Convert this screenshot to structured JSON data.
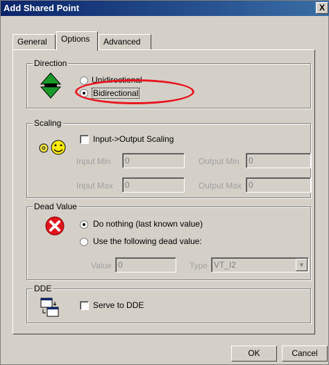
{
  "window": {
    "title": "Add Shared Point",
    "close_label": "X"
  },
  "tabs": [
    {
      "label": "General"
    },
    {
      "label": "Options"
    },
    {
      "label": "Advanced"
    }
  ],
  "direction": {
    "legend": "Direction",
    "unidirectional_label": "Unidirectional",
    "bidirectional_label": "Bidirectional",
    "selected": "Bidirectional"
  },
  "scaling": {
    "legend": "Scaling",
    "checkbox_label": "Input->Output Scaling",
    "input_min_label": "Input Min",
    "input_min_value": "0",
    "output_min_label": "Output Min",
    "output_min_value": "0",
    "input_max_label": "Input Max",
    "input_max_value": "0",
    "output_max_label": "Output Max",
    "output_max_value": "0"
  },
  "dead_value": {
    "legend": "Dead Value",
    "option1_label": "Do nothing (last known value)",
    "option2_label": "Use the following dead value:",
    "value_label": "Value",
    "value_value": "0",
    "type_label": "Type",
    "type_value": "VT_I2"
  },
  "dde": {
    "legend": "DDE",
    "checkbox_label": "Serve to DDE"
  },
  "buttons": {
    "ok": "OK",
    "cancel": "Cancel"
  },
  "colors": {
    "highlight_ellipse": "#e8141e",
    "titlebar": "#0a246a"
  }
}
